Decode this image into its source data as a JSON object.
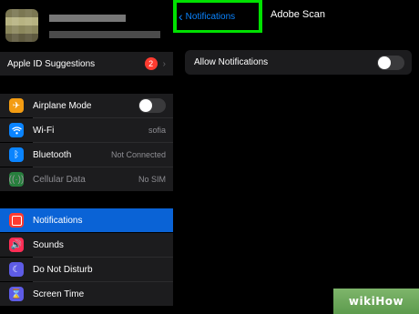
{
  "sidebar": {
    "apple_id_suggestions": {
      "label": "Apple ID Suggestions",
      "badge": "2"
    },
    "connectivity": [
      {
        "label": "Airplane Mode",
        "icon": "airplane-icon",
        "color": "#f39c12",
        "value": "",
        "toggle": true
      },
      {
        "label": "Wi-Fi",
        "icon": "wifi-icon",
        "color": "#0a84ff",
        "value": "sofia",
        "toggle": false
      },
      {
        "label": "Bluetooth",
        "icon": "bluetooth-icon",
        "color": "#0a84ff",
        "value": "Not Connected",
        "toggle": false
      },
      {
        "label": "Cellular Data",
        "icon": "cellular-icon",
        "color": "#30d158",
        "value": "No SIM",
        "toggle": false
      }
    ],
    "system": [
      {
        "label": "Notifications",
        "icon": "notifications-icon",
        "color": "#ff3b30",
        "selected": true
      },
      {
        "label": "Sounds",
        "icon": "sounds-icon",
        "color": "#ff2d55",
        "selected": false
      },
      {
        "label": "Do Not Disturb",
        "icon": "moon-icon",
        "color": "#5e5ce6",
        "selected": false
      },
      {
        "label": "Screen Time",
        "icon": "hourglass-icon",
        "color": "#5e5ce6",
        "selected": false
      }
    ]
  },
  "nav": {
    "back_label": "Notifications",
    "title": "Adobe Scan",
    "highlight_color": "#00e100"
  },
  "main": {
    "allow_notifications": {
      "label": "Allow Notifications",
      "enabled": false
    }
  },
  "watermark": {
    "text": "wikiHow"
  }
}
